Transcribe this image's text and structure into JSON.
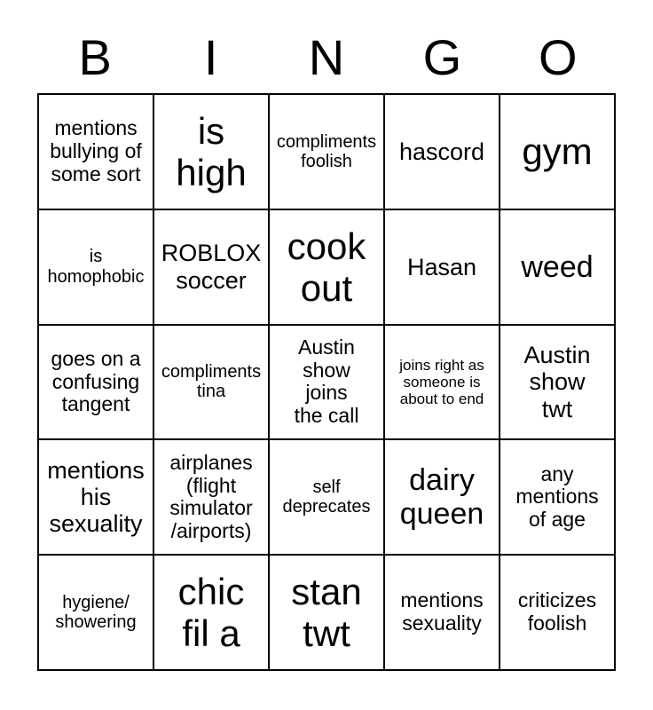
{
  "card": {
    "header_letters": [
      "B",
      "I",
      "N",
      "G",
      "O"
    ],
    "rows": [
      [
        {
          "text": "mentions\nbullying of\nsome sort",
          "size": "m"
        },
        {
          "text": "is\nhigh",
          "size": "xxl"
        },
        {
          "text": "compliments\nfoolish",
          "size": "s"
        },
        {
          "text": "hascord",
          "size": "l"
        },
        {
          "text": "gym",
          "size": "xxl"
        }
      ],
      [
        {
          "text": "is\nhomophobic",
          "size": "s"
        },
        {
          "text": "ROBLOX\nsoccer",
          "size": "l"
        },
        {
          "text": "cook\nout",
          "size": "xxl"
        },
        {
          "text": "Hasan",
          "size": "l"
        },
        {
          "text": "weed",
          "size": "xl"
        }
      ],
      [
        {
          "text": "goes on a\nconfusing\ntangent",
          "size": "m"
        },
        {
          "text": "compliments\ntina",
          "size": "s"
        },
        {
          "text": "Austin\nshow\njoins\nthe call",
          "size": "m"
        },
        {
          "text": "joins right as\nsomeone is\nabout to end",
          "size": "xs"
        },
        {
          "text": "Austin\nshow\ntwt",
          "size": "l"
        }
      ],
      [
        {
          "text": "mentions\nhis\nsexuality",
          "size": "l"
        },
        {
          "text": "airplanes\n(flight\nsimulator\n/airports)",
          "size": "m"
        },
        {
          "text": "self\ndeprecates",
          "size": "s"
        },
        {
          "text": "dairy\nqueen",
          "size": "xl"
        },
        {
          "text": "any\nmentions\nof age",
          "size": "m"
        }
      ],
      [
        {
          "text": "hygiene/\nshowering",
          "size": "s"
        },
        {
          "text": "chic\nfil a",
          "size": "xxl"
        },
        {
          "text": "stan\ntwt",
          "size": "xxl"
        },
        {
          "text": "mentions\nsexuality",
          "size": "m"
        },
        {
          "text": "criticizes\nfoolish",
          "size": "m"
        }
      ]
    ]
  }
}
